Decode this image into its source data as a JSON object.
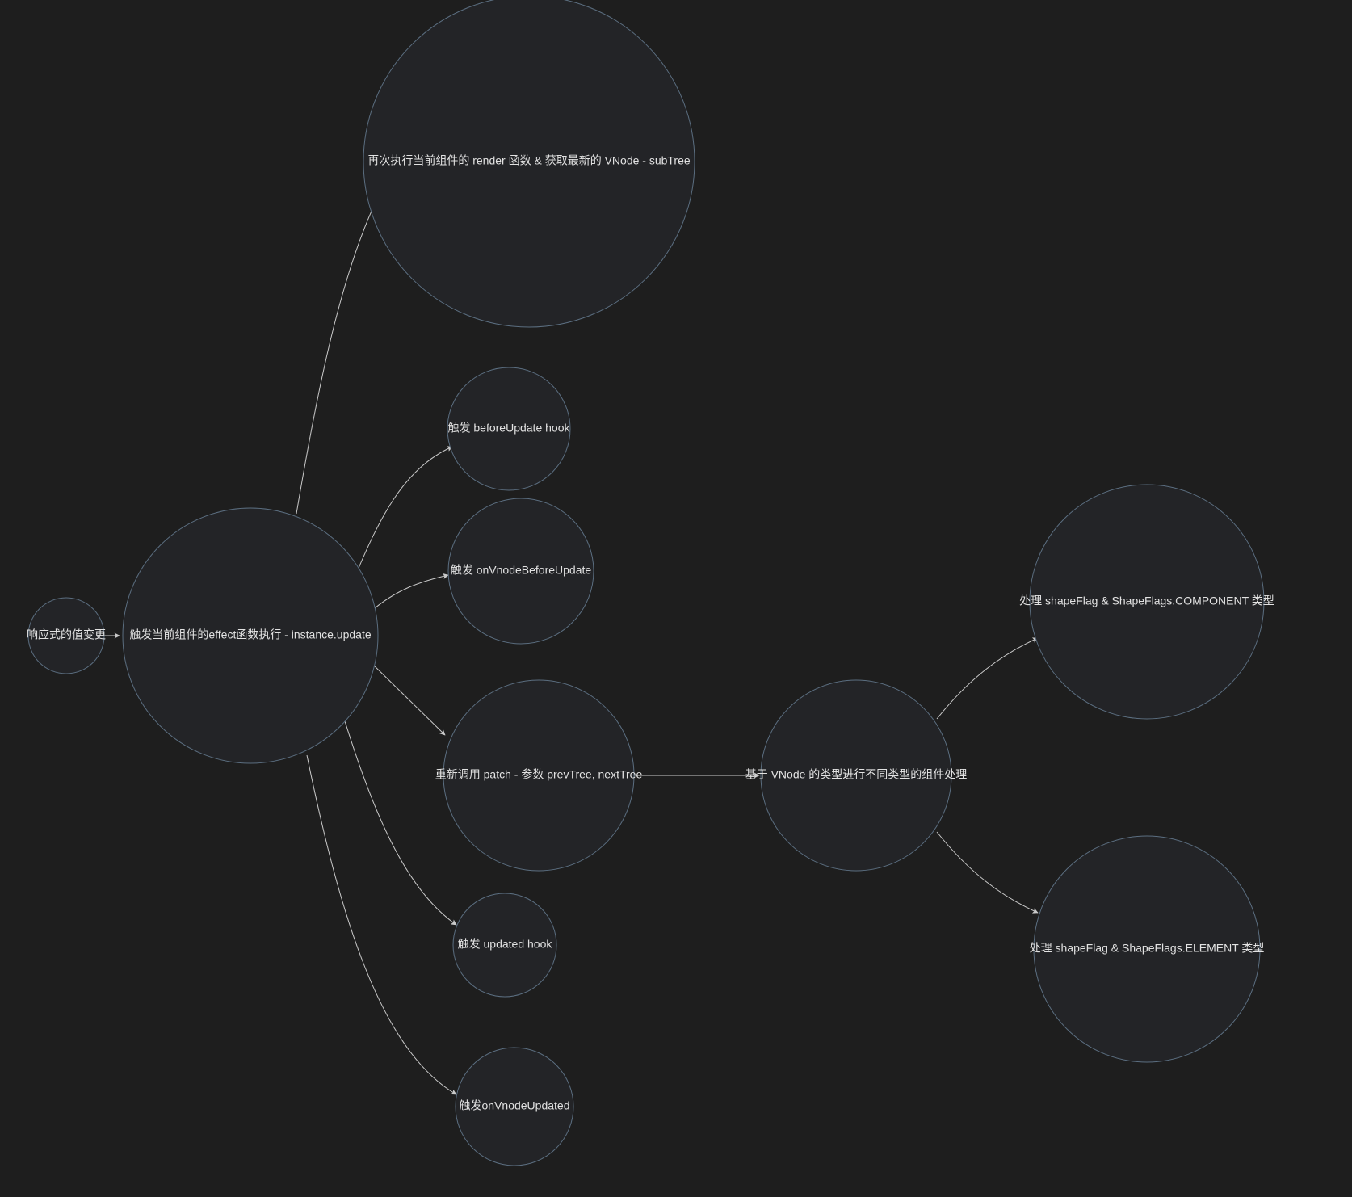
{
  "diagram": {
    "background": "#1e1e1e",
    "nodeFill": "#232427",
    "nodeStroke": "#5b6e80",
    "textColor": "#e2e2e2",
    "edgeColor": "#c9c9c9",
    "nodes": {
      "root": {
        "label": "响应式的值变更"
      },
      "effect": {
        "label": "触发当前组件的effect函数执行 - instance.update"
      },
      "rerender": {
        "label": "再次执行当前组件的 render 函数 & 获取最新的 VNode - subTree"
      },
      "beforeUpdate": {
        "label": "触发 beforeUpdate hook"
      },
      "vnodeBefore": {
        "label": "触发 onVnodeBeforeUpdate"
      },
      "patch": {
        "label": "重新调用 patch - 参数 prevTree, nextTree"
      },
      "typeDispatch": {
        "label": "基于 VNode 的类型进行不同类型的组件处理"
      },
      "componentFlag": {
        "label": "处理 shapeFlag & ShapeFlags.COMPONENT 类型"
      },
      "elementFlag": {
        "label": "处理 shapeFlag & ShapeFlags.ELEMENT 类型"
      },
      "updatedHook": {
        "label": "触发 updated hook"
      },
      "vnodeUpdated": {
        "label": "触发onVnodeUpdated"
      }
    }
  }
}
